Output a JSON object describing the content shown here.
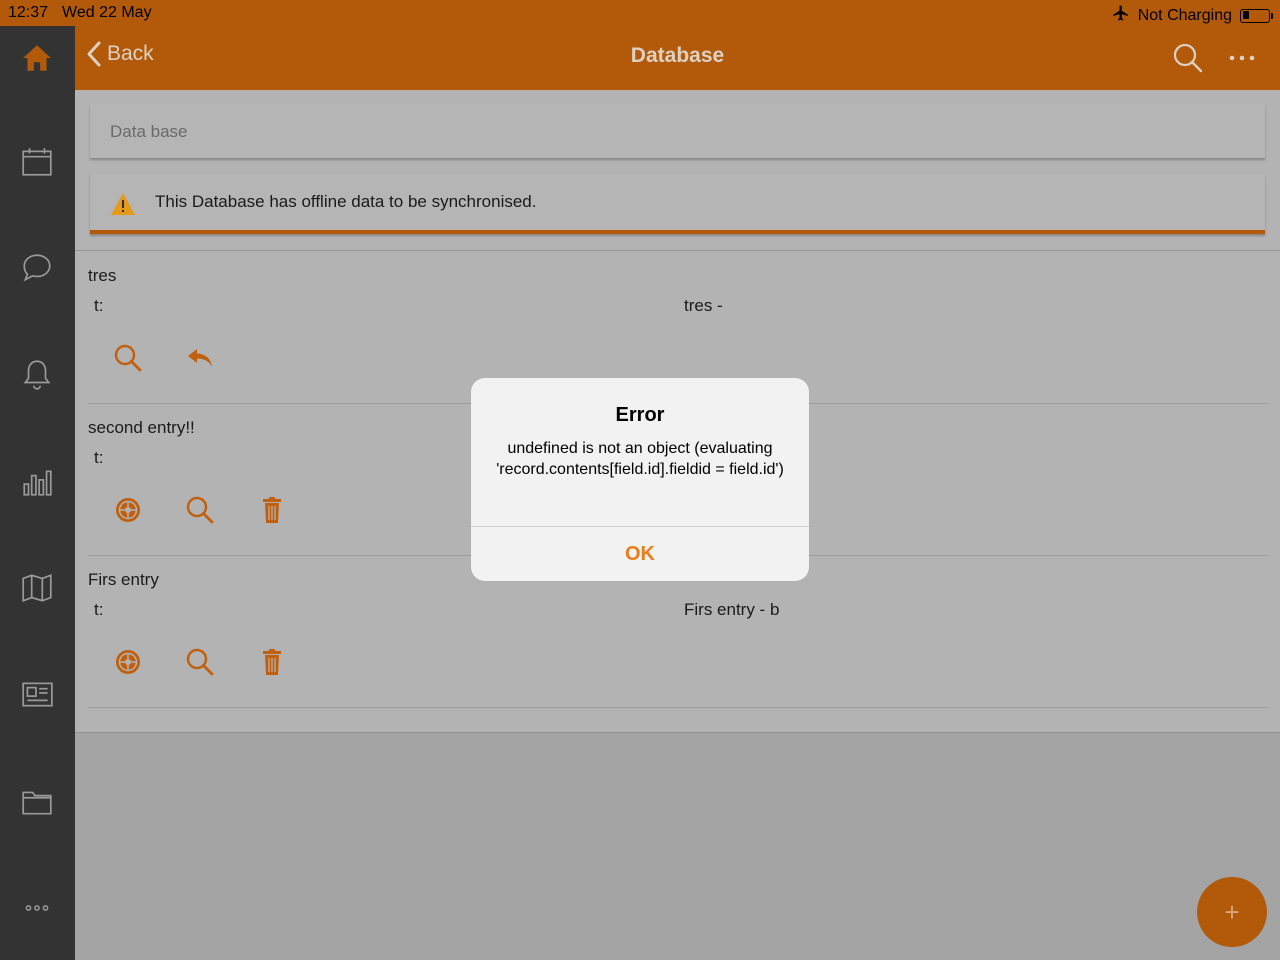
{
  "status_bar": {
    "time": "12:37",
    "date": "Wed 22 May",
    "charging": "Not Charging"
  },
  "sidebar": {
    "items": [
      "home-icon",
      "calendar-icon",
      "chat-icon",
      "bell-icon",
      "chart-icon",
      "map-icon",
      "newspaper-icon",
      "folder-icon",
      "more-icon"
    ]
  },
  "header": {
    "back_label": "Back",
    "title": "Database"
  },
  "database": {
    "name_placeholder": "Data base",
    "offline_notice": "This Database has offline data to be synchronised."
  },
  "records": [
    {
      "title": "tres",
      "label": "t:",
      "value": "tres -"
    },
    {
      "title": "second entry!!",
      "label": "t:",
      "value": ""
    },
    {
      "title": "Firs entry",
      "label": "t:",
      "value": "Firs entry - b"
    }
  ],
  "fab": {
    "label": "+"
  },
  "dialog": {
    "title": "Error",
    "message": "undefined is not an object (evaluating 'record.contents[field.id].fieldid = field.id')",
    "ok_label": "OK"
  },
  "colors": {
    "accent": "#b25a0a",
    "sidebar": "#333333",
    "ok_text": "#e87f1e"
  }
}
